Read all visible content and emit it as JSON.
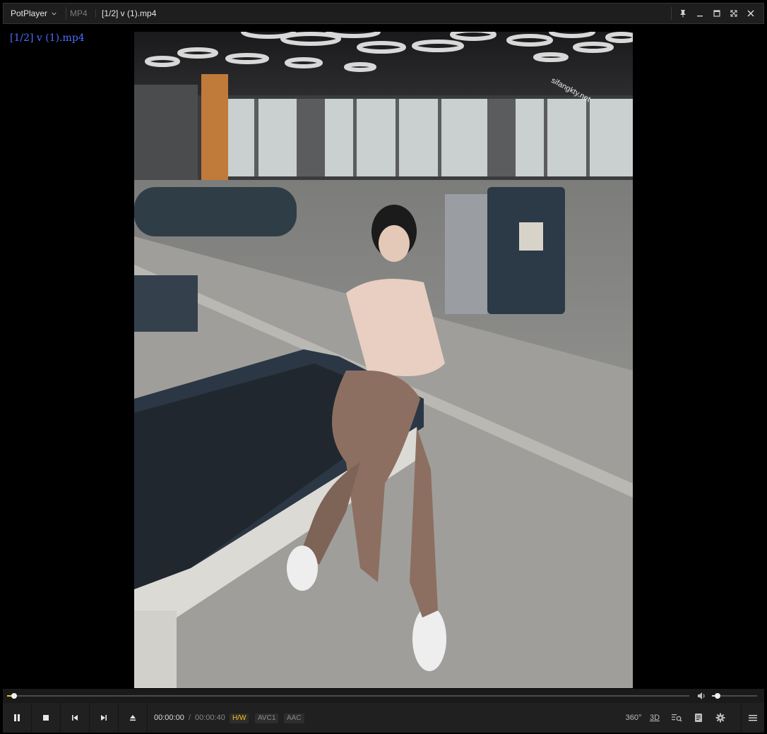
{
  "titlebar": {
    "app_menu_label": "PotPlayer",
    "format": "MP4",
    "file_title": "[1/2] v (1).mp4"
  },
  "osd": {
    "text": "[1/2] v (1).mp4"
  },
  "watermark": {
    "text": "sifangkty.net"
  },
  "playback": {
    "current_time": "00:00:00",
    "separator": "/",
    "total_time": "00:00:40",
    "progress_fraction": 0.01,
    "volume_fraction": 0.12
  },
  "tags": {
    "hw": "H/W",
    "video_codec": "AVC1",
    "audio_codec": "AAC"
  },
  "right_icons": {
    "vr360": "360°",
    "stereo3d": "3D"
  },
  "colors": {
    "accent": "#f5c518",
    "osd_text": "#4d6bff",
    "bar_bg": "#202020"
  }
}
